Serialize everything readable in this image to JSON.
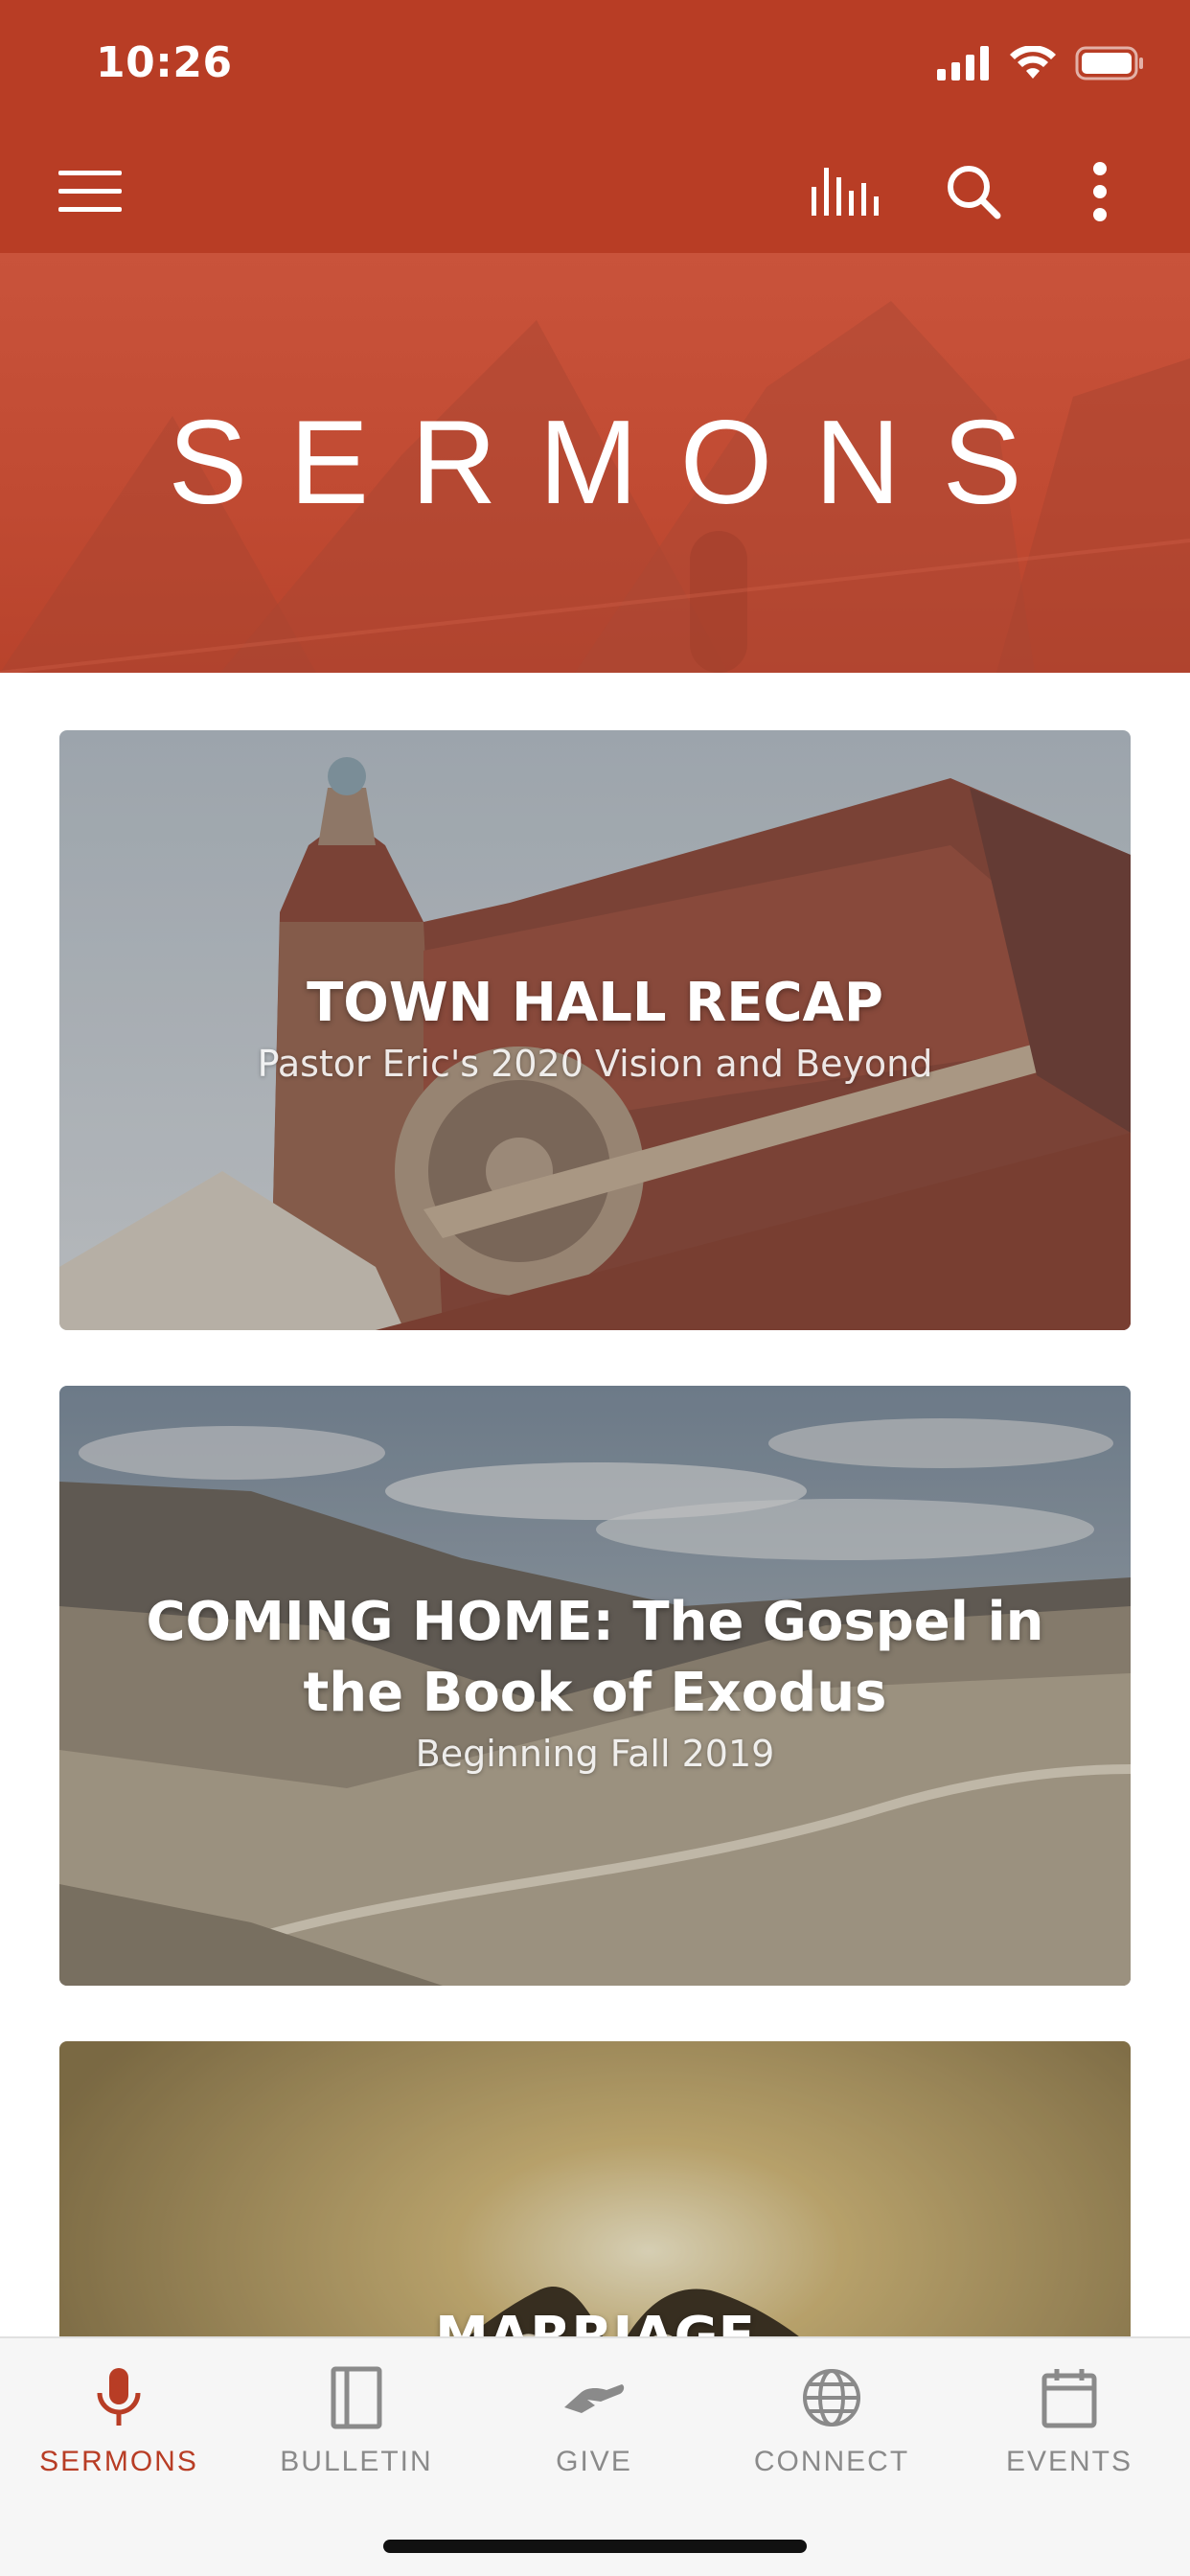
{
  "status_bar": {
    "time": "10:26",
    "icons": [
      "cellular-signal-icon",
      "wifi-icon",
      "battery-icon"
    ]
  },
  "toolbar": {
    "icons": [
      "menu-icon",
      "audio-bars-icon",
      "search-icon",
      "more-vertical-icon"
    ]
  },
  "hero": {
    "title": "SERMONS"
  },
  "cards": [
    {
      "title": "TOWN HALL RECAP",
      "subtitle": "Pastor Eric's 2020 Vision and Beyond"
    },
    {
      "title_line1": "COMING HOME: The Gospel in",
      "title_line2": "the Book of Exodus",
      "subtitle": "Beginning Fall 2019"
    },
    {
      "title": "MARRIAGE"
    }
  ],
  "tabs": [
    {
      "label": "SERMONS",
      "icon": "microphone-icon",
      "active": true
    },
    {
      "label": "BULLETIN",
      "icon": "book-icon",
      "active": false
    },
    {
      "label": "GIVE",
      "icon": "hand-give-icon",
      "active": false
    },
    {
      "label": "CONNECT",
      "icon": "globe-icon",
      "active": false
    },
    {
      "label": "EVENTS",
      "icon": "calendar-icon",
      "active": false
    }
  ],
  "colors": {
    "brand": "#b83d25",
    "tab_inactive": "#8a8a8a",
    "tab_bar_bg": "#f6f6f6"
  }
}
